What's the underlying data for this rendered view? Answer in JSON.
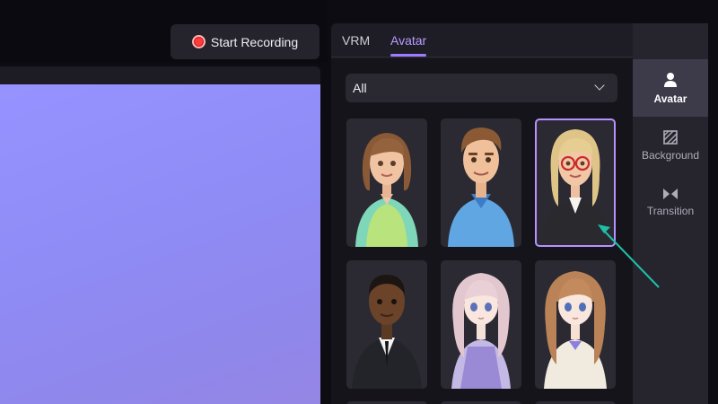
{
  "toolbar": {
    "record_label": "Start Recording"
  },
  "panel": {
    "tabs": [
      {
        "label": "VRM"
      },
      {
        "label": "Avatar"
      }
    ],
    "filter": {
      "selected": "All"
    }
  },
  "sidenav": {
    "items": [
      {
        "label": "Avatar",
        "icon": "person-icon"
      },
      {
        "label": "Background",
        "icon": "background-icon"
      },
      {
        "label": "Transition",
        "icon": "transition-icon"
      }
    ]
  },
  "avatars": [
    {
      "name": "avatar-woman-brown-hair"
    },
    {
      "name": "avatar-man-quiff"
    },
    {
      "name": "avatar-woman-glasses",
      "selected": true
    },
    {
      "name": "avatar-man-suit"
    },
    {
      "name": "avatar-anime-girl-lavender"
    },
    {
      "name": "avatar-anime-girl-brown"
    }
  ],
  "colors": {
    "accent": "#9d7cff",
    "record": "#ff3b3b",
    "arrow": "#1fbfa8"
  }
}
